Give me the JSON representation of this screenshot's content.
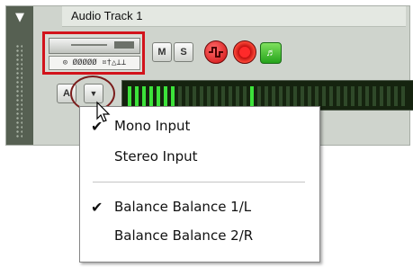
{
  "track": {
    "name": "Audio Track 1",
    "collapse_icon": "triangle-down-icon",
    "io_label": "⊙ ØØØØØ ¤†△⊥⊥"
  },
  "buttons": {
    "mute": "M",
    "solo": "S",
    "auto": "A",
    "input_menu_icon": "dropdown-arrow-icon",
    "phase_icon": "waveform-icon",
    "record_icon": "record-icon",
    "monitor_icon": "speaker-icon"
  },
  "meter": {
    "lit_segments": [
      1,
      1,
      1,
      1,
      1,
      1,
      1,
      0,
      0,
      0,
      0,
      0,
      0,
      0,
      0,
      0,
      0,
      1,
      0,
      0,
      0,
      0,
      0,
      0,
      0,
      0,
      0,
      0,
      0,
      0,
      0,
      0,
      0,
      0,
      0,
      0,
      0,
      0,
      0
    ],
    "lit_color": "#3ce23a",
    "unlit_color": "#2f4929"
  },
  "context_menu": {
    "items": [
      {
        "label": "Mono Input",
        "checked": true
      },
      {
        "label": "Stereo Input",
        "checked": false
      },
      {
        "label": "Balance Balance 1/L",
        "checked": true
      },
      {
        "label": "Balance Balance 2/R",
        "checked": false
      }
    ],
    "check_mark": "✔"
  },
  "colors": {
    "highlight_red": "#d2131b",
    "button_red": "#e01b1b",
    "monitor_green": "#25a31b"
  }
}
